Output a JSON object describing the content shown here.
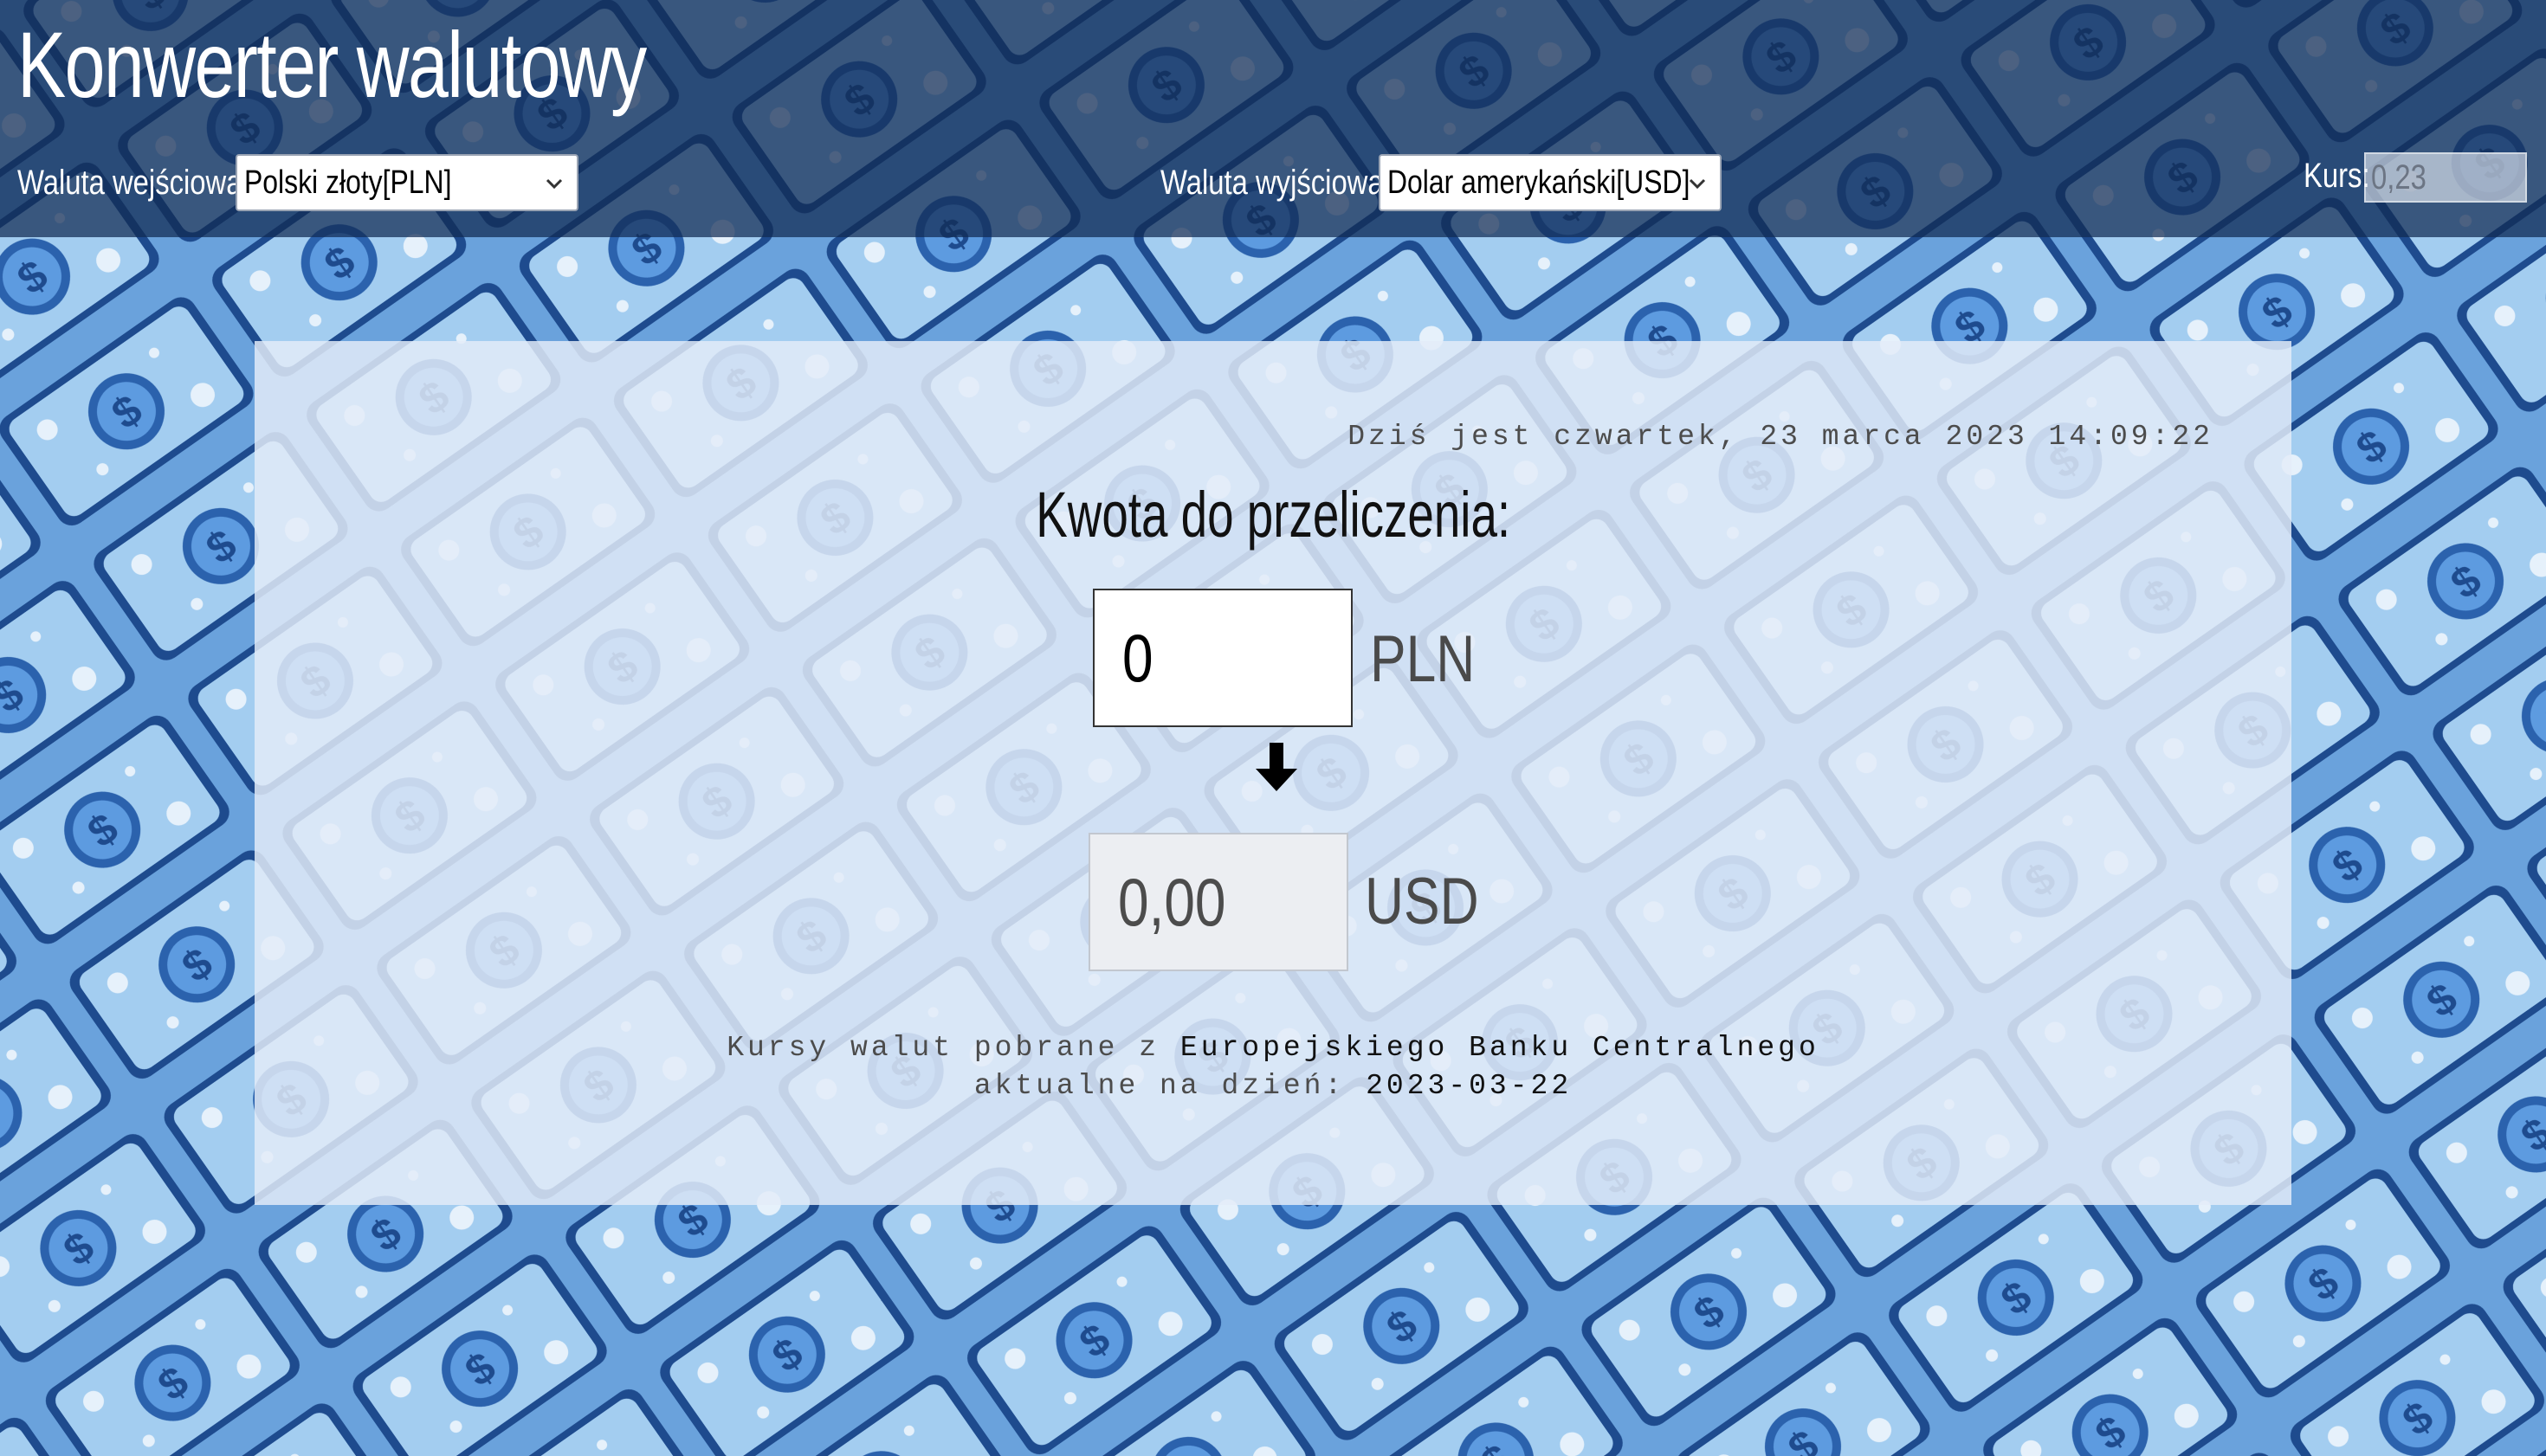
{
  "header": {
    "title": "Konwerter walutowy",
    "input_currency_label": "Waluta wejściowa:",
    "input_currency_value": "Polski złoty[PLN]",
    "output_currency_label": "Waluta wyjściowa:",
    "output_currency_value": "Dolar amerykański[USD]",
    "rate_label": "Kurs:",
    "rate_value": "0,23"
  },
  "main": {
    "date_text": "Dziś jest czwartek, 23 marca 2023 14:09:22",
    "heading": "Kwota do przeliczenia:",
    "input_amount": "0",
    "input_unit": "PLN",
    "output_amount": "0,00",
    "output_unit": "USD",
    "source_prefix": "Kursy walut pobrane z",
    "source_name": "Europejskiego Banku Centralnego",
    "updated_prefix": "aktualne na dzień:",
    "updated_date": "2023-03-22"
  },
  "colors": {
    "background": "#6aa2dc",
    "header_overlay": "#102a52",
    "banknote_light": "#a3cdf0",
    "banknote_dark": "#1e4b8e",
    "panel": "#e4ecf8"
  },
  "icons": {
    "background_pattern": "dollar-banknote-pattern",
    "dropdown": "chevron-down-icon",
    "convert": "arrow-down-icon"
  }
}
